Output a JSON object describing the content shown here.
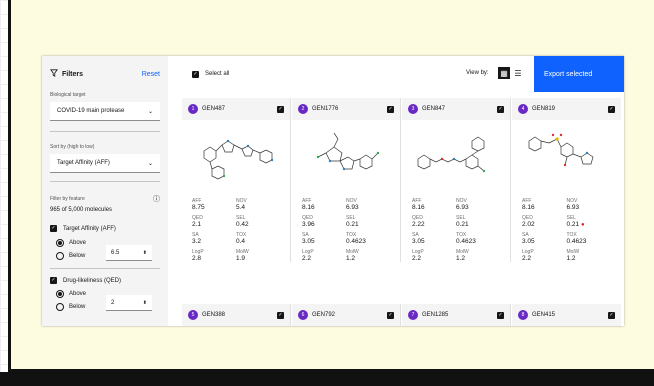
{
  "sidebar": {
    "title": "Filters",
    "reset": "Reset",
    "bio_target_label": "Biological target",
    "bio_target_value": "COVID-19 main protease",
    "sort_label": "Sort by (high to low)",
    "sort_value": "Target Affinity (AFF)",
    "filter_label": "Filter by feature",
    "count": "965 of 5,000 molecules",
    "filters": [
      {
        "name": "Target Affinity (AFF)",
        "above": "Above",
        "below": "Below",
        "value": "6.5"
      },
      {
        "name": "Drug-likeliness (QED)",
        "above": "Above",
        "below": "Below",
        "value": "2"
      }
    ]
  },
  "toolbar": {
    "select_all": "Select all",
    "view_by": "View by:",
    "export": "Export selected"
  },
  "colors": {
    "accent": "#0f62fe",
    "badge": "#6929c4",
    "alert": "#da1e28"
  },
  "labels": {
    "aff": "AFF",
    "nov": "NOV",
    "qed": "QED",
    "sel": "SEL",
    "sa": "SA",
    "tox": "TOX",
    "logp": "LogP",
    "molw": "MolW"
  },
  "cards": [
    {
      "num": "1",
      "name": "GEN487",
      "aff": "8.75",
      "nov": "5.4",
      "qed": "2.1",
      "sel": "0.42",
      "sa": "3.2",
      "tox": "0.4",
      "logp": "2.8",
      "molw": "1.9"
    },
    {
      "num": "2",
      "name": "GEN1776",
      "aff": "8.16",
      "nov": "6.93",
      "qed": "3.96",
      "sel": "0.21",
      "sa": "3.05",
      "tox": "0.4623",
      "logp": "2.2",
      "molw": "1.2"
    },
    {
      "num": "3",
      "name": "GEN847",
      "aff": "8.16",
      "nov": "6.93",
      "qed": "2.22",
      "sel": "0.21",
      "sa": "3.05",
      "tox": "0.4623",
      "logp": "2.2",
      "molw": "1.2"
    },
    {
      "num": "4",
      "name": "GEN819",
      "aff": "8.16",
      "nov": "6.93",
      "qed": "2.02",
      "sel": "0.21",
      "sa": "3.05",
      "tox": "0.4623",
      "logp": "2.2",
      "molw": "1.2"
    },
    {
      "num": "5",
      "name": "GEN388"
    },
    {
      "num": "6",
      "name": "GEN792"
    },
    {
      "num": "7",
      "name": "GEN1285"
    },
    {
      "num": "8",
      "name": "GEN415"
    }
  ]
}
